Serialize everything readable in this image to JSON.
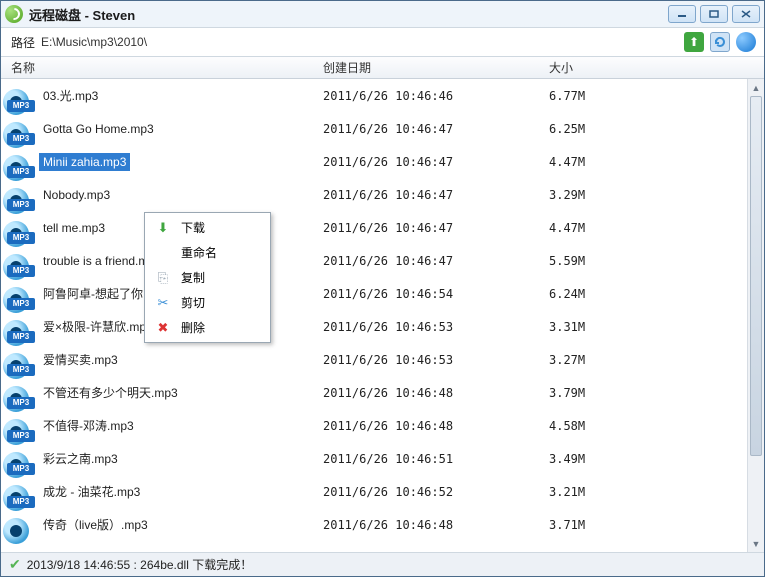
{
  "window": {
    "title": "远程磁盘  - Steven"
  },
  "path": {
    "label": "路径",
    "value": "E:\\Music\\mp3\\2010\\"
  },
  "headers": {
    "name": "名称",
    "date": "创建日期",
    "size": "大小"
  },
  "files": [
    {
      "name": "03.光.mp3",
      "date": "2011/6/26 10:46:46",
      "size": "6.77M",
      "sel": false
    },
    {
      "name": "Gotta Go Home.mp3",
      "date": "2011/6/26 10:46:47",
      "size": "6.25M",
      "sel": false
    },
    {
      "name": "Minii zahia.mp3",
      "date": "2011/6/26 10:46:47",
      "size": "4.47M",
      "sel": true
    },
    {
      "name": "Nobody.mp3",
      "date": "2011/6/26 10:46:47",
      "size": "3.29M",
      "sel": false
    },
    {
      "name": "tell me.mp3",
      "date": "2011/6/26 10:46:47",
      "size": "4.47M",
      "sel": false
    },
    {
      "name": "trouble is a friend.mp3",
      "date": "2011/6/26 10:46:47",
      "size": "5.59M",
      "sel": false
    },
    {
      "name": "阿鲁阿卓-想起了你.mp3",
      "date": "2011/6/26 10:46:54",
      "size": "6.24M",
      "sel": false
    },
    {
      "name": "爱×极限-许慧欣.mp3",
      "date": "2011/6/26 10:46:53",
      "size": "3.31M",
      "sel": false
    },
    {
      "name": "爱情买卖.mp3",
      "date": "2011/6/26 10:46:53",
      "size": "3.27M",
      "sel": false
    },
    {
      "name": "不管还有多少个明天.mp3",
      "date": "2011/6/26 10:46:48",
      "size": "3.79M",
      "sel": false
    },
    {
      "name": "不值得-邓涛.mp3",
      "date": "2011/6/26 10:46:48",
      "size": "4.58M",
      "sel": false
    },
    {
      "name": "彩云之南.mp3",
      "date": "2011/6/26 10:46:51",
      "size": "3.49M",
      "sel": false
    },
    {
      "name": "成龙 - 油菜花.mp3",
      "date": "2011/6/26 10:46:52",
      "size": "3.21M",
      "sel": false
    },
    {
      "name": "传奇（live版）.mp3",
      "date": "2011/6/26 10:46:48",
      "size": "3.71M",
      "sel": false
    }
  ],
  "context": [
    {
      "icon": "⬇",
      "color": "#3fa63f",
      "label": "下载"
    },
    {
      "icon": "",
      "label": "重命名"
    },
    {
      "icon": "⎘",
      "color": "#9aa7b3",
      "label": "复制"
    },
    {
      "icon": "✂",
      "color": "#3a8fd6",
      "label": "剪切"
    },
    {
      "icon": "✖",
      "color": "#d33",
      "label": "删除"
    }
  ],
  "status": {
    "text": "2013/9/18 14:46:55 :   264be.dll 下载完成！"
  },
  "icons": {
    "mp3": "MP3",
    "up": "⬆"
  }
}
